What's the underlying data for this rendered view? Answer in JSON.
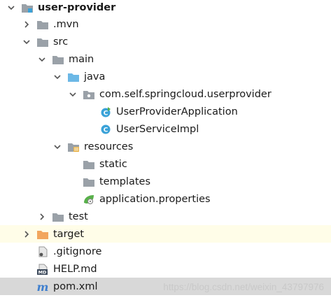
{
  "project_tree": {
    "root_label": "user-provider",
    "items": [
      {
        "label": ".mvn"
      },
      {
        "label": "src"
      },
      {
        "label": "main"
      },
      {
        "label": "java"
      },
      {
        "label": "com.self.springcloud.userprovider"
      },
      {
        "label": "UserProviderApplication"
      },
      {
        "label": "UserServiceImpl"
      },
      {
        "label": "resources"
      },
      {
        "label": "static"
      },
      {
        "label": "templates"
      },
      {
        "label": "application.properties"
      },
      {
        "label": "test"
      },
      {
        "label": "target"
      },
      {
        "label": ".gitignore"
      },
      {
        "label": "HELP.md"
      },
      {
        "label": "pom.xml"
      }
    ]
  },
  "watermark": "https://blog.csdn.net/weixin_43797976",
  "colors": {
    "folder_gray": "#9aa1a8",
    "folder_blue": "#6cb8e6",
    "folder_orange": "#f2a65e",
    "class_icon": "#3aa2d8",
    "highlight_row": "#fffde8",
    "selected_row": "#d8d8d8",
    "maven_blue": "#3f7fce"
  }
}
